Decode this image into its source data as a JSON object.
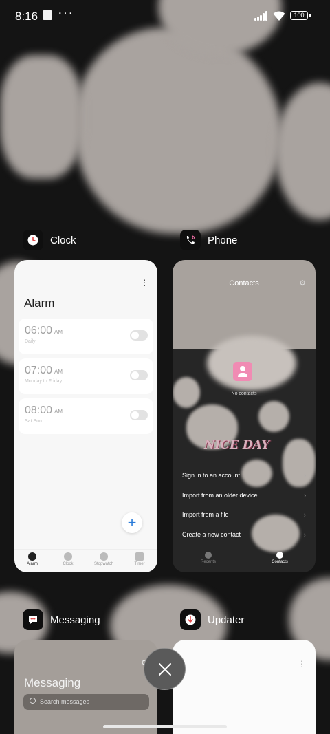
{
  "status_bar": {
    "time": "8:16",
    "more": "···",
    "battery": "100"
  },
  "apps": {
    "clock": {
      "name": "Clock",
      "screen_title": "Alarm",
      "alarms": [
        {
          "time": "06:00",
          "period": "AM",
          "repeat": "Daily",
          "enabled": false
        },
        {
          "time": "07:00",
          "period": "AM",
          "repeat": "Monday to Friday",
          "enabled": false
        },
        {
          "time": "08:00",
          "period": "AM",
          "repeat": "Sat Sun",
          "enabled": false
        }
      ],
      "add_label": "+",
      "nav": [
        {
          "label": "Alarm",
          "active": true
        },
        {
          "label": "Clock",
          "active": false
        },
        {
          "label": "Stopwatch",
          "active": false
        },
        {
          "label": "Timer",
          "active": false
        }
      ]
    },
    "phone": {
      "name": "Phone",
      "screen_title": "Contacts",
      "empty_text": "No contacts",
      "wallpaper_text": "NICE DAY",
      "options": [
        "Sign in to an account",
        "Import from an older device",
        "Import from a file",
        "Create a new contact"
      ],
      "nav": [
        {
          "label": "Recents",
          "active": false
        },
        {
          "label": "Contacts",
          "active": true
        }
      ]
    },
    "messaging": {
      "name": "Messaging",
      "screen_title": "Messaging",
      "search_placeholder": "Search messages"
    },
    "updater": {
      "name": "Updater"
    }
  },
  "colors": {
    "accent_blue": "#2a7bd9",
    "contact_pink": "#f08bb3",
    "wallpaper_light": "#a9a39f",
    "wallpaper_dark": "#141414"
  }
}
